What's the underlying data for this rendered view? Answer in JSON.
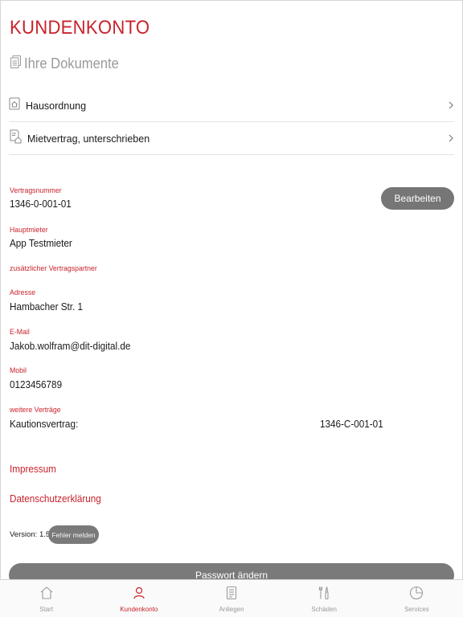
{
  "page": {
    "title": "KUNDENKONTO"
  },
  "documents": {
    "heading": "Ihre Dokumente",
    "items": [
      {
        "label": "Hausordnung",
        "icon": "house-document-icon"
      },
      {
        "label": "Mietvertrag, unterschrieben",
        "icon": "contract-document-icon"
      }
    ]
  },
  "contract": {
    "number_label": "Vertragsnummer",
    "number_value": "1346-0-001-01",
    "edit_label": "Bearbeiten",
    "tenant_label": "Hauptmieter",
    "tenant_value": "App Testmieter",
    "partner_label": "zusätzlicher Vertragspartner",
    "address_label": "Adresse",
    "address_value": "Hambacher Str. 1",
    "email_label": "E-Mail",
    "email_value": "Jakob.wolfram@dit-digital.de",
    "mobile_label": "Mobil",
    "mobile_value": "0123456789",
    "more_label": "weitere Verträge",
    "more_name": "Kautionsvertrag:",
    "more_number": "1346-C-001-01"
  },
  "links": {
    "imprint": "Impressum",
    "privacy": "Datenschutzerklärung"
  },
  "footer": {
    "version": "Version: 1.5.5",
    "report": "Fehler melden",
    "password": "Passwort ändern"
  },
  "tabs": [
    {
      "label": "Start",
      "icon": "home-icon"
    },
    {
      "label": "Kundenkonto",
      "icon": "user-icon"
    },
    {
      "label": "Anliegen",
      "icon": "document-icon"
    },
    {
      "label": "Schäden",
      "icon": "tools-icon"
    },
    {
      "label": "Services",
      "icon": "pie-chart-icon"
    }
  ],
  "colors": {
    "accent": "#c8232c",
    "button_gray": "#767676",
    "muted": "#9a9a9a"
  }
}
